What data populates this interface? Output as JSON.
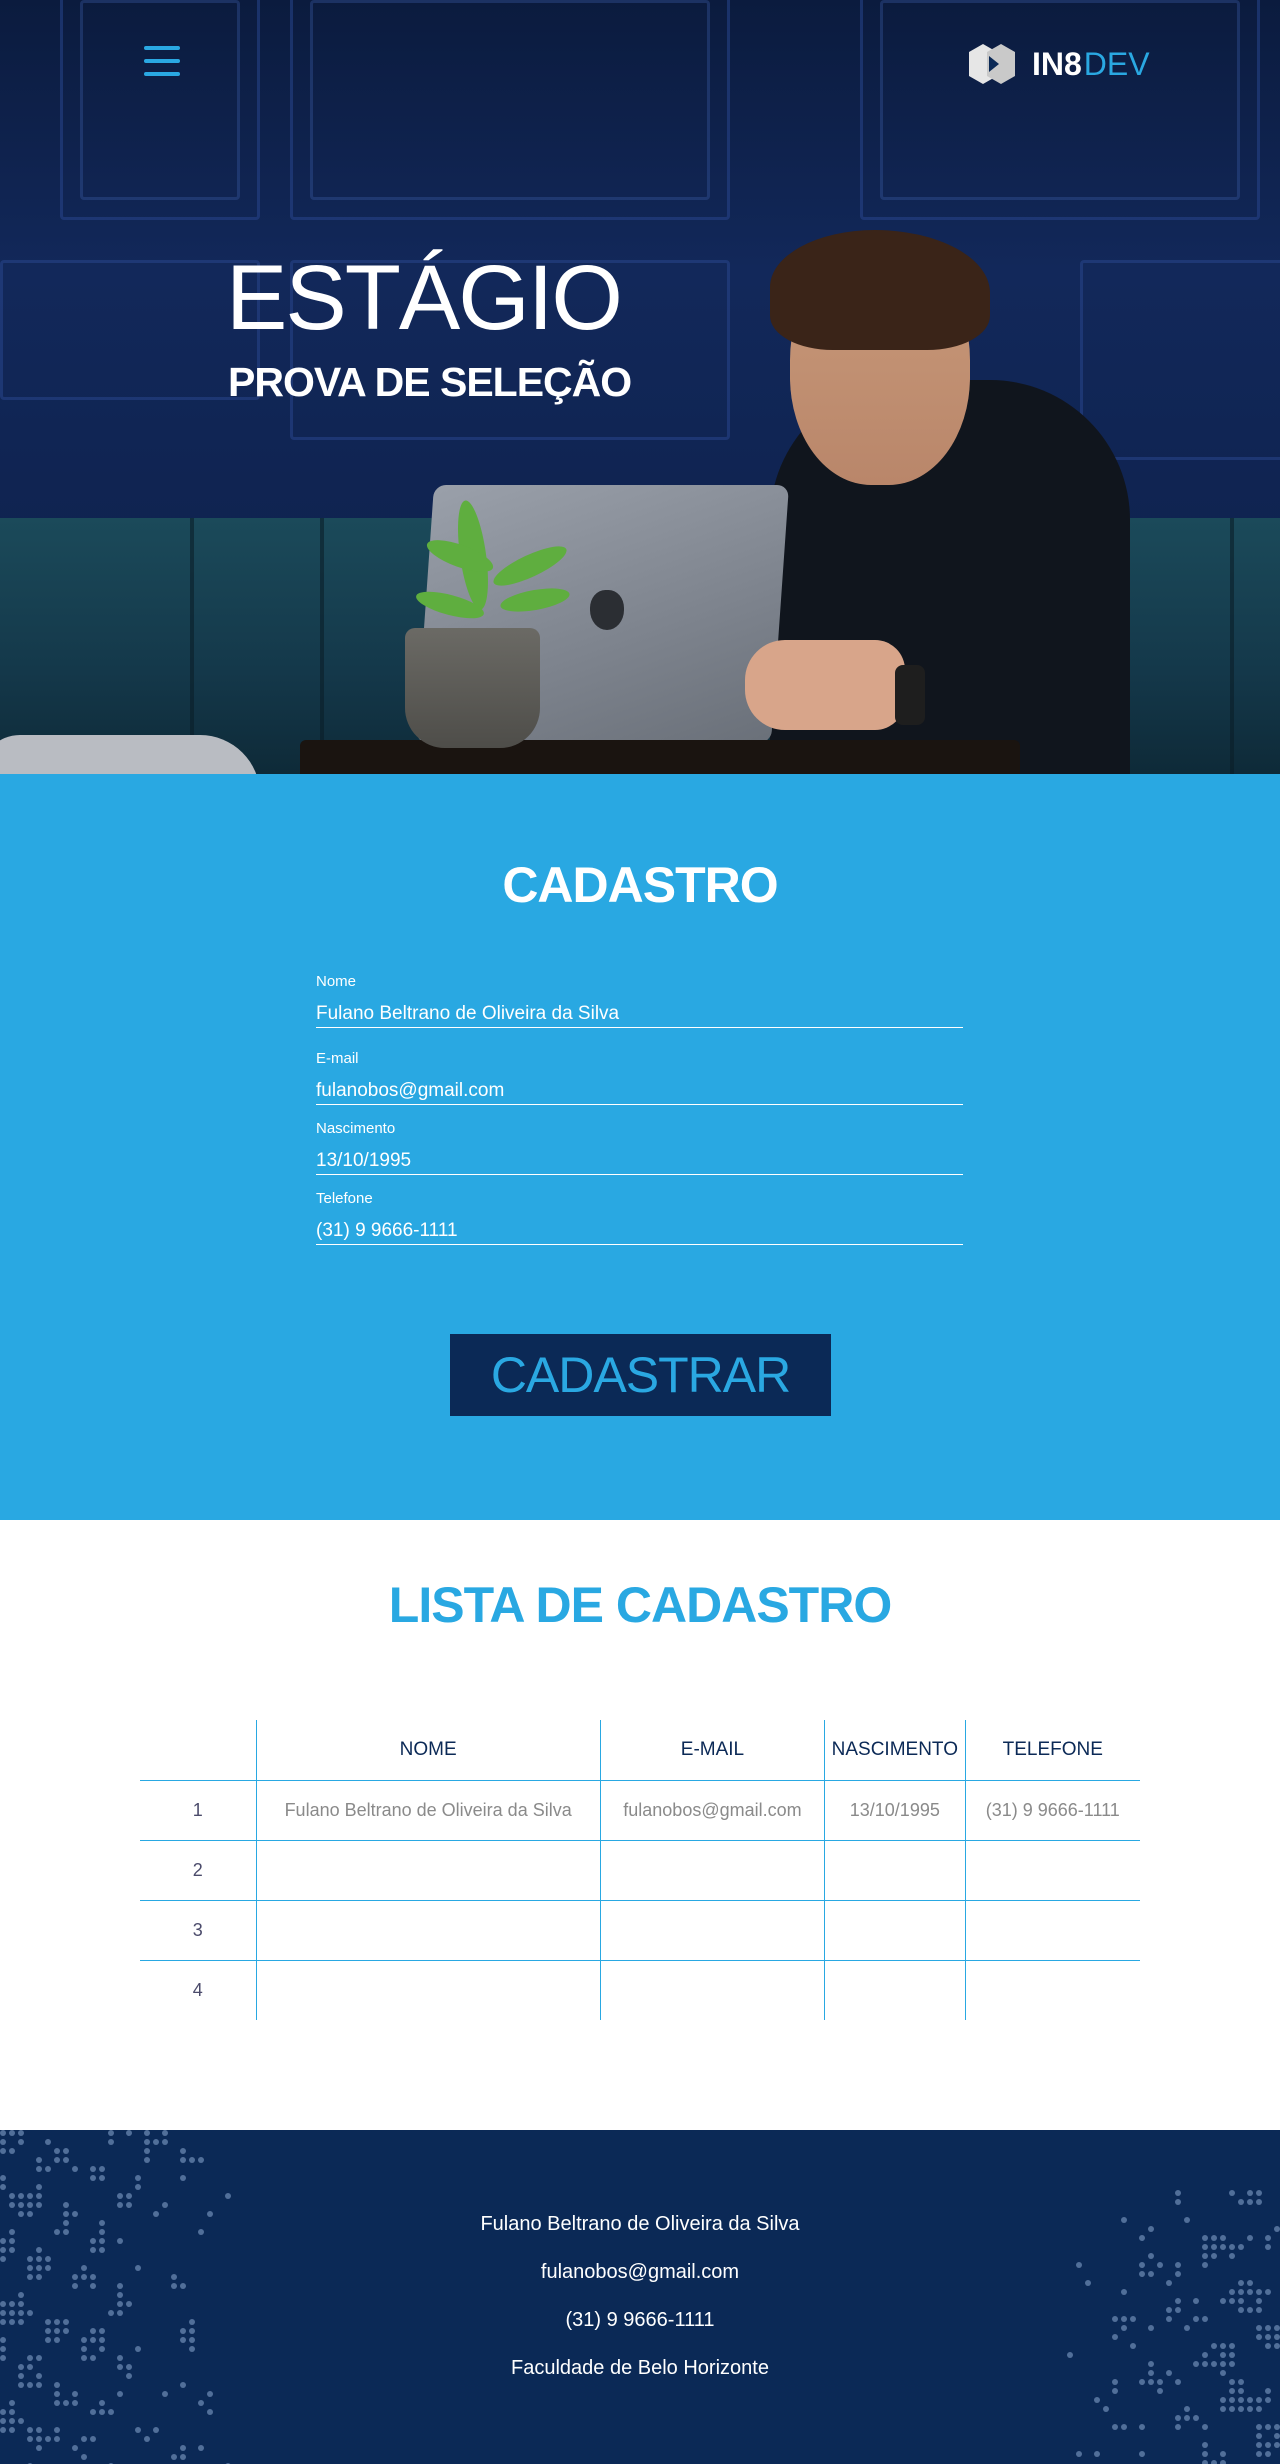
{
  "header": {
    "menu_icon": "hamburger-menu-icon",
    "logo": {
      "mark_icon": "hexagon-logo-icon",
      "text_bold": "IN8",
      "text_light": "DEV"
    }
  },
  "hero": {
    "title": "ESTÁGIO",
    "subtitle": "PROVA DE SELEÇÃO"
  },
  "cadastro": {
    "title": "CADASTRO",
    "fields": [
      {
        "label": "Nome",
        "value": "Fulano Beltrano de Oliveira da Silva"
      },
      {
        "label": "E-mail",
        "value": "fulanobos@gmail.com"
      },
      {
        "label": "Nascimento",
        "value": "13/10/1995"
      },
      {
        "label": "Telefone",
        "value": "(31) 9 9666-1111"
      }
    ],
    "submit_label": "CADASTRAR"
  },
  "lista": {
    "title": "LISTA DE CADASTRO",
    "columns": [
      "",
      "NOME",
      "E-MAIL",
      "NASCIMENTO",
      "TELEFONE"
    ],
    "rows": [
      [
        "1",
        "Fulano Beltrano de Oliveira da Silva",
        "fulanobos@gmail.com",
        "13/10/1995",
        "(31) 9 9666-1111"
      ],
      [
        "2",
        "",
        "",
        "",
        ""
      ],
      [
        "3",
        "",
        "",
        "",
        ""
      ],
      [
        "4",
        "",
        "",
        "",
        ""
      ]
    ]
  },
  "footer": {
    "lines": [
      "Fulano Beltrano de Oliveira da Silva",
      "fulanobos@gmail.com",
      "(31) 9 9666-1111",
      "Faculdade de Belo Horizonte"
    ]
  },
  "colors": {
    "accent": "#29a8e2",
    "navy": "#0b2956",
    "white": "#ffffff"
  }
}
